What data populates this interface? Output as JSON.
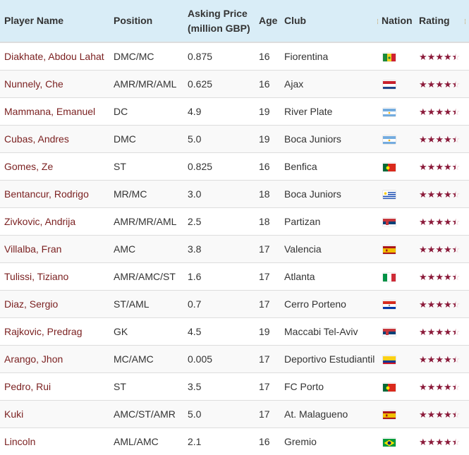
{
  "headers": {
    "name": "Player Name",
    "position": "Position",
    "price_line1": "Asking Price",
    "price_line2": "(million GBP)",
    "age": "Age",
    "club": "Club",
    "nation": "Nation",
    "rating": "Rating"
  },
  "colors": {
    "header_bg": "#d9edf7",
    "name_link": "#7a1f1f",
    "star": "#8b1a3a",
    "row_alt": "#f9f9f9"
  },
  "rows": [
    {
      "name": "Diakhate, Abdou Lahat",
      "position": "DMC/MC",
      "price": "0.875",
      "age": "16",
      "club": "Fiorentina",
      "nation": "Senegal",
      "rating": 4.5
    },
    {
      "name": "Nunnely, Che",
      "position": "AMR/MR/AML",
      "price": "0.625",
      "age": "16",
      "club": "Ajax",
      "nation": "Netherlands",
      "rating": 4.5
    },
    {
      "name": "Mammana, Emanuel",
      "position": "DC",
      "price": "4.9",
      "age": "19",
      "club": "River Plate",
      "nation": "Argentina",
      "rating": 4.5
    },
    {
      "name": "Cubas, Andres",
      "position": "DMC",
      "price": "5.0",
      "age": "19",
      "club": "Boca Juniors",
      "nation": "Argentina",
      "rating": 4.5
    },
    {
      "name": "Gomes, Ze",
      "position": "ST",
      "price": "0.825",
      "age": "16",
      "club": "Benfica",
      "nation": "Portugal",
      "rating": 4.5
    },
    {
      "name": "Bentancur, Rodrigo",
      "position": "MR/MC",
      "price": "3.0",
      "age": "18",
      "club": "Boca Juniors",
      "nation": "Uruguay",
      "rating": 4.5
    },
    {
      "name": "Zivkovic, Andrija",
      "position": "AMR/MR/AML",
      "price": "2.5",
      "age": "18",
      "club": "Partizan",
      "nation": "Serbia",
      "rating": 4.5
    },
    {
      "name": "Villalba, Fran",
      "position": "AMC",
      "price": "3.8",
      "age": "17",
      "club": "Valencia",
      "nation": "Spain",
      "rating": 4.5
    },
    {
      "name": "Tulissi, Tiziano",
      "position": "AMR/AMC/ST",
      "price": "1.6",
      "age": "17",
      "club": "Atlanta",
      "nation": "Italy",
      "rating": 4.5
    },
    {
      "name": "Diaz, Sergio",
      "position": "ST/AML",
      "price": "0.7",
      "age": "17",
      "club": "Cerro Porteno",
      "nation": "Paraguay",
      "rating": 4.5
    },
    {
      "name": "Rajkovic, Predrag",
      "position": "GK",
      "price": "4.5",
      "age": "19",
      "club": "Maccabi Tel-Aviv",
      "nation": "Serbia",
      "rating": 4.5
    },
    {
      "name": "Arango, Jhon",
      "position": "MC/AMC",
      "price": "0.005",
      "age": "17",
      "club": "Deportivo Estudiantil",
      "nation": "Colombia",
      "rating": 4.5
    },
    {
      "name": "Pedro, Rui",
      "position": "ST",
      "price": "3.5",
      "age": "17",
      "club": "FC Porto",
      "nation": "Portugal",
      "rating": 4.5
    },
    {
      "name": "Kuki",
      "position": "AMC/ST/AMR",
      "price": "5.0",
      "age": "17",
      "club": "At. Malagueno",
      "nation": "Spain",
      "rating": 4.5
    },
    {
      "name": "Lincoln",
      "position": "AML/AMC",
      "price": "2.1",
      "age": "16",
      "club": "Gremio",
      "nation": "Brazil",
      "rating": 4.5
    }
  ]
}
